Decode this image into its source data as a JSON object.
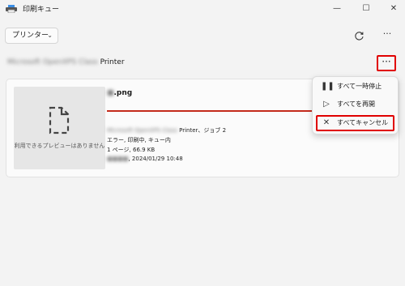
{
  "window": {
    "title": "印刷キュー",
    "controls": {
      "minimize": "—",
      "maximize": "☐",
      "close": "✕"
    }
  },
  "toolbar": {
    "printer_select_label": "プリンター",
    "refresh_icon": "refresh-icon",
    "more_icon": "ellipsis-icon"
  },
  "printer": {
    "name_blurred": "Microsoft OpenXPS Class",
    "name_suffix": "Printer",
    "more_label": "···"
  },
  "job": {
    "name_blurred": "■",
    "name_suffix": ".png",
    "preview_unavailable": "利用できるプレビューはありません",
    "printer_line_blurred": "Microsoft OpenXPS Class",
    "printer_line_suffix": "Printer、ジョブ 2",
    "status_line": "エラー, 印刷中, キュー内",
    "size_line": "1 ページ, 66.9 KB",
    "owner_blurred": "■■■■",
    "timestamp": ", 2024/01/29 10:48"
  },
  "context_menu": {
    "items": [
      {
        "label": "すべて一時停止",
        "icon": "pause-icon"
      },
      {
        "label": "すべてを再開",
        "icon": "play-icon"
      },
      {
        "label": "すべてキャンセル",
        "icon": "close-icon"
      }
    ]
  },
  "colors": {
    "highlight": "#e00000",
    "progress": "#c42b1c"
  }
}
